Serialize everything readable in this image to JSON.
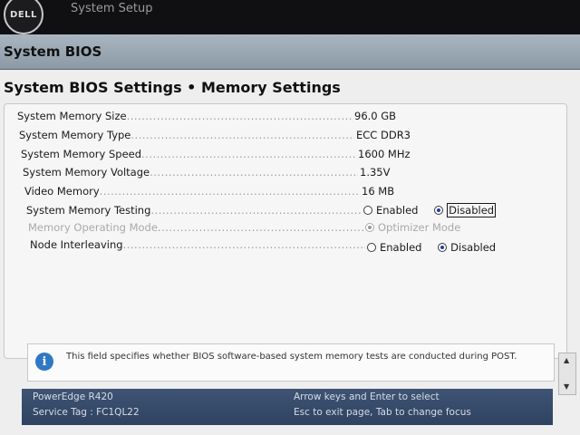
{
  "brand": {
    "logo_text": "DELL"
  },
  "app": {
    "title": "System Setup"
  },
  "header": {
    "title": "System BIOS"
  },
  "page": {
    "title": "System BIOS Settings • Memory Settings"
  },
  "settings": [
    {
      "label": "System Memory Size",
      "value": "96.0 GB"
    },
    {
      "label": "System Memory Type",
      "value": "ECC DDR3"
    },
    {
      "label": "System Memory Speed",
      "value": "1600 MHz"
    },
    {
      "label": "System Memory Voltage",
      "value": "1.35V"
    },
    {
      "label": "Video Memory",
      "value": "16 MB"
    },
    {
      "label": "System Memory Testing",
      "options": [
        "Enabled",
        "Disabled"
      ],
      "selected": "Disabled"
    },
    {
      "label": "Memory Operating Mode",
      "options": [
        "Optimizer Mode"
      ],
      "selected": "Optimizer Mode",
      "disabled": true
    },
    {
      "label": "Node Interleaving",
      "options": [
        "Enabled",
        "Disabled"
      ],
      "selected": "Disabled"
    }
  ],
  "help": {
    "text": "This field specifies whether BIOS software-based system memory tests are conducted during POST."
  },
  "status": {
    "model": "PowerEdge R420",
    "service_tag": "Service Tag : FC1QL22",
    "hint1": "Arrow keys and Enter to select",
    "hint2": "Esc to exit page, Tab to change focus"
  },
  "colors": {
    "header_bar": "#9aa7b3",
    "status_bar": "#34496a",
    "radio_selected": "#1f3fa8",
    "info_icon": "#2f78c5"
  }
}
